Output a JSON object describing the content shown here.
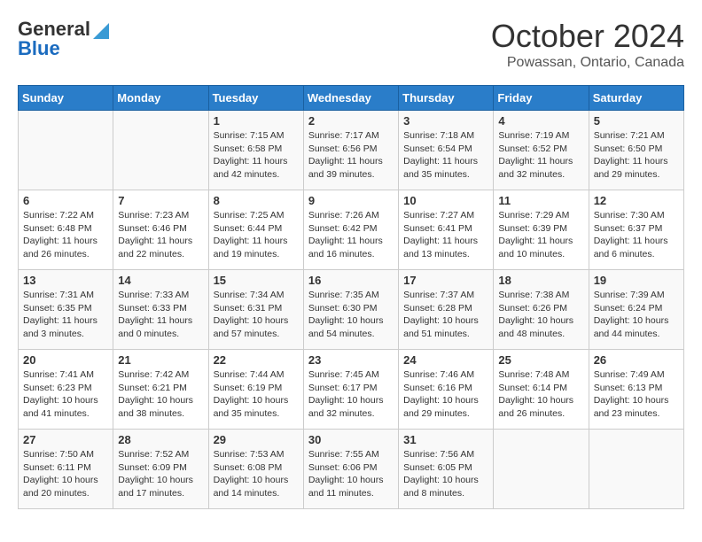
{
  "logo": {
    "line1": "General",
    "line2": "Blue"
  },
  "title": "October 2024",
  "subtitle": "Powassan, Ontario, Canada",
  "days_header": [
    "Sunday",
    "Monday",
    "Tuesday",
    "Wednesday",
    "Thursday",
    "Friday",
    "Saturday"
  ],
  "weeks": [
    [
      {
        "day": "",
        "info": ""
      },
      {
        "day": "",
        "info": ""
      },
      {
        "day": "1",
        "info": "Sunrise: 7:15 AM\nSunset: 6:58 PM\nDaylight: 11 hours and 42 minutes."
      },
      {
        "day": "2",
        "info": "Sunrise: 7:17 AM\nSunset: 6:56 PM\nDaylight: 11 hours and 39 minutes."
      },
      {
        "day": "3",
        "info": "Sunrise: 7:18 AM\nSunset: 6:54 PM\nDaylight: 11 hours and 35 minutes."
      },
      {
        "day": "4",
        "info": "Sunrise: 7:19 AM\nSunset: 6:52 PM\nDaylight: 11 hours and 32 minutes."
      },
      {
        "day": "5",
        "info": "Sunrise: 7:21 AM\nSunset: 6:50 PM\nDaylight: 11 hours and 29 minutes."
      }
    ],
    [
      {
        "day": "6",
        "info": "Sunrise: 7:22 AM\nSunset: 6:48 PM\nDaylight: 11 hours and 26 minutes."
      },
      {
        "day": "7",
        "info": "Sunrise: 7:23 AM\nSunset: 6:46 PM\nDaylight: 11 hours and 22 minutes."
      },
      {
        "day": "8",
        "info": "Sunrise: 7:25 AM\nSunset: 6:44 PM\nDaylight: 11 hours and 19 minutes."
      },
      {
        "day": "9",
        "info": "Sunrise: 7:26 AM\nSunset: 6:42 PM\nDaylight: 11 hours and 16 minutes."
      },
      {
        "day": "10",
        "info": "Sunrise: 7:27 AM\nSunset: 6:41 PM\nDaylight: 11 hours and 13 minutes."
      },
      {
        "day": "11",
        "info": "Sunrise: 7:29 AM\nSunset: 6:39 PM\nDaylight: 11 hours and 10 minutes."
      },
      {
        "day": "12",
        "info": "Sunrise: 7:30 AM\nSunset: 6:37 PM\nDaylight: 11 hours and 6 minutes."
      }
    ],
    [
      {
        "day": "13",
        "info": "Sunrise: 7:31 AM\nSunset: 6:35 PM\nDaylight: 11 hours and 3 minutes."
      },
      {
        "day": "14",
        "info": "Sunrise: 7:33 AM\nSunset: 6:33 PM\nDaylight: 11 hours and 0 minutes."
      },
      {
        "day": "15",
        "info": "Sunrise: 7:34 AM\nSunset: 6:31 PM\nDaylight: 10 hours and 57 minutes."
      },
      {
        "day": "16",
        "info": "Sunrise: 7:35 AM\nSunset: 6:30 PM\nDaylight: 10 hours and 54 minutes."
      },
      {
        "day": "17",
        "info": "Sunrise: 7:37 AM\nSunset: 6:28 PM\nDaylight: 10 hours and 51 minutes."
      },
      {
        "day": "18",
        "info": "Sunrise: 7:38 AM\nSunset: 6:26 PM\nDaylight: 10 hours and 48 minutes."
      },
      {
        "day": "19",
        "info": "Sunrise: 7:39 AM\nSunset: 6:24 PM\nDaylight: 10 hours and 44 minutes."
      }
    ],
    [
      {
        "day": "20",
        "info": "Sunrise: 7:41 AM\nSunset: 6:23 PM\nDaylight: 10 hours and 41 minutes."
      },
      {
        "day": "21",
        "info": "Sunrise: 7:42 AM\nSunset: 6:21 PM\nDaylight: 10 hours and 38 minutes."
      },
      {
        "day": "22",
        "info": "Sunrise: 7:44 AM\nSunset: 6:19 PM\nDaylight: 10 hours and 35 minutes."
      },
      {
        "day": "23",
        "info": "Sunrise: 7:45 AM\nSunset: 6:17 PM\nDaylight: 10 hours and 32 minutes."
      },
      {
        "day": "24",
        "info": "Sunrise: 7:46 AM\nSunset: 6:16 PM\nDaylight: 10 hours and 29 minutes."
      },
      {
        "day": "25",
        "info": "Sunrise: 7:48 AM\nSunset: 6:14 PM\nDaylight: 10 hours and 26 minutes."
      },
      {
        "day": "26",
        "info": "Sunrise: 7:49 AM\nSunset: 6:13 PM\nDaylight: 10 hours and 23 minutes."
      }
    ],
    [
      {
        "day": "27",
        "info": "Sunrise: 7:50 AM\nSunset: 6:11 PM\nDaylight: 10 hours and 20 minutes."
      },
      {
        "day": "28",
        "info": "Sunrise: 7:52 AM\nSunset: 6:09 PM\nDaylight: 10 hours and 17 minutes."
      },
      {
        "day": "29",
        "info": "Sunrise: 7:53 AM\nSunset: 6:08 PM\nDaylight: 10 hours and 14 minutes."
      },
      {
        "day": "30",
        "info": "Sunrise: 7:55 AM\nSunset: 6:06 PM\nDaylight: 10 hours and 11 minutes."
      },
      {
        "day": "31",
        "info": "Sunrise: 7:56 AM\nSunset: 6:05 PM\nDaylight: 10 hours and 8 minutes."
      },
      {
        "day": "",
        "info": ""
      },
      {
        "day": "",
        "info": ""
      }
    ]
  ]
}
